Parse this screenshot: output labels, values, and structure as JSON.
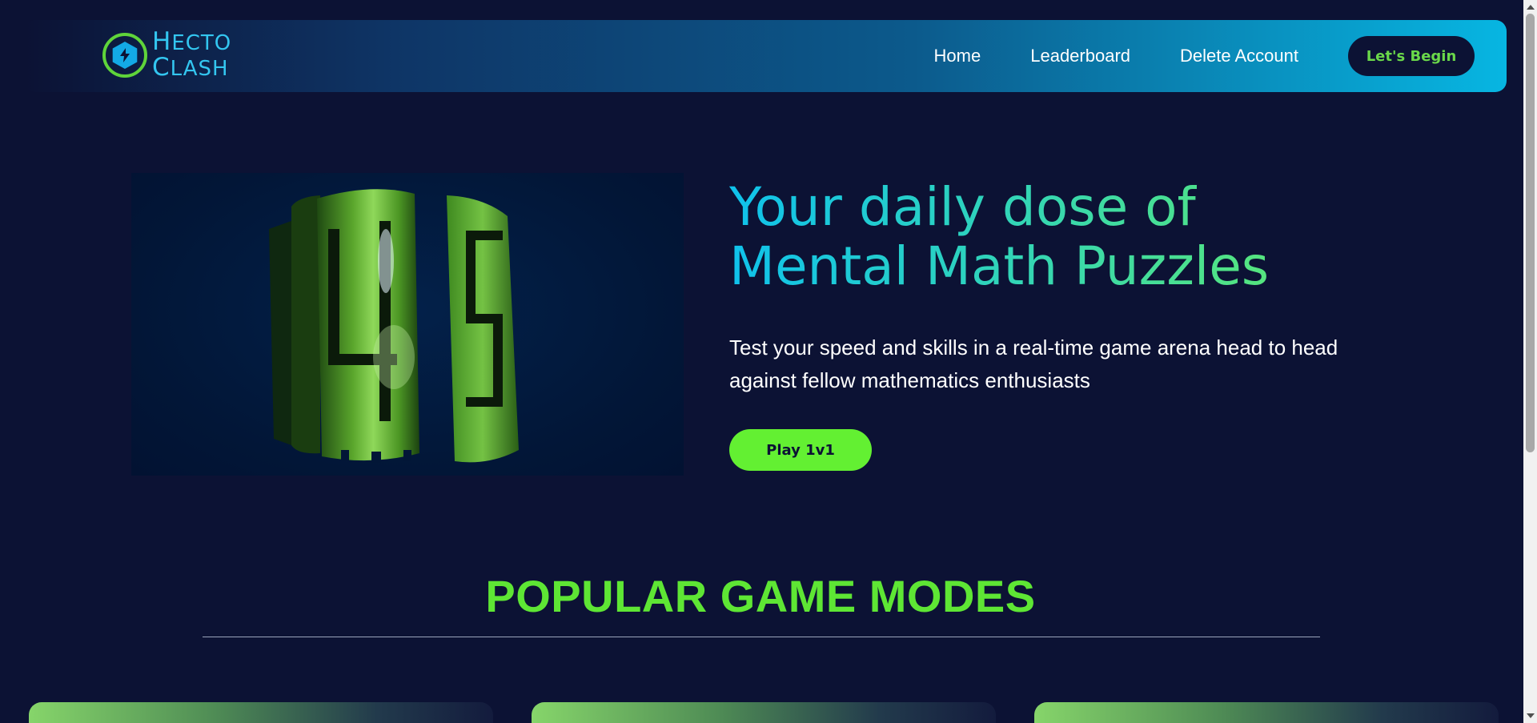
{
  "brand": {
    "line1_first": "H",
    "line1_rest": "ECTO",
    "line2_first": "C",
    "line2_rest": "LASH",
    "icon": "lightning-bolt-icon",
    "colors": {
      "ring": "#5fd43a",
      "hex": "#13a9e6",
      "text": "#33c6f0"
    }
  },
  "nav": {
    "links": [
      {
        "label": "Home"
      },
      {
        "label": "Leaderboard"
      },
      {
        "label": "Delete Account"
      }
    ],
    "cta_label": "Let's Begin"
  },
  "hero": {
    "title_line1": "Your daily dose of",
    "title_line2": "Mental Math Puzzles",
    "description": "Test your speed and skills in a real-time game arena head to head against fellow mathematics enthusiasts",
    "play_label": "Play 1v1",
    "image_icon": "rotating-3d-number-icon"
  },
  "section": {
    "title": "POPULAR GAME MODES"
  },
  "colors": {
    "background": "#0c1234",
    "accent_green": "#63f032",
    "accent_cyan": "#0fc2ec",
    "nav_gradient_end": "#07b6e2"
  }
}
